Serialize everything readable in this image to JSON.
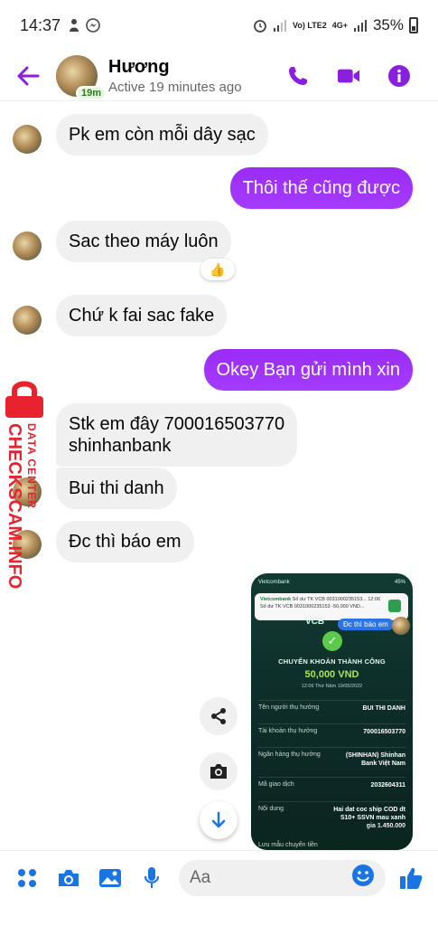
{
  "status_bar": {
    "time": "14:37",
    "network": "Vo) LTE2",
    "network_4g": "4G+",
    "battery": "35%"
  },
  "header": {
    "name": "Hương",
    "status": "Active 19 minutes ago",
    "badge": "19m",
    "accent_color": "#8b1fe0"
  },
  "messages": [
    {
      "dir": "in",
      "text": "Pk em còn mỗi dây sạc"
    },
    {
      "dir": "out",
      "text": "Thôi thế cũng được"
    },
    {
      "dir": "in",
      "text": "Sac theo máy luôn",
      "reaction": "👍"
    },
    {
      "dir": "in",
      "text": "Chứ k fai sac fake"
    },
    {
      "dir": "out",
      "text": "Okey Bạn gửi mình xin"
    },
    {
      "dir": "in",
      "text_line1": "Stk em đây 700016503770",
      "text_line2": "shinhanbank"
    },
    {
      "dir": "in",
      "text": "Bui thi danh"
    },
    {
      "dir": "in",
      "text": "Đc thì báo em"
    }
  ],
  "watermark": {
    "line1": "DATA CENTER",
    "line2": "CHECKSCAM.INFO"
  },
  "shared_image": {
    "bank_app": "Vietcombank",
    "status_battery": "45%",
    "notification_title": "Vietcombank",
    "notification_sub": "Số dư TK VCB 0031000235153...",
    "notification_time": "12:06",
    "notification_body": "Số dư TK VCB 0031000235153 -50,000 VND...",
    "partial_bank": "VCB",
    "pill": "Đc thì báo em",
    "success_title": "CHUYỂN KHOẢN THÀNH CÔNG",
    "amount": "50,000 VND",
    "datetime": "12:06 Thứ Năm 19/05/2022",
    "rows": [
      {
        "k": "Tên người thụ hưởng",
        "v": "BUI THI DANH"
      },
      {
        "k": "Tài khoản thụ hưởng",
        "v": "700016503770"
      },
      {
        "k": "Ngân hàng thụ hưởng",
        "v": "(SHINHAN) Shinhan Bank Việt Nam"
      },
      {
        "k": "Mã giao dịch",
        "v": "2032604311"
      },
      {
        "k": "Nội dung",
        "v": "Hai dat coc ship COD dt S10+ SSVN mau xanh gia 1.450.000"
      }
    ],
    "save_label": "Lưu mẫu chuyển tiền"
  },
  "composer": {
    "placeholder": "Aa"
  }
}
